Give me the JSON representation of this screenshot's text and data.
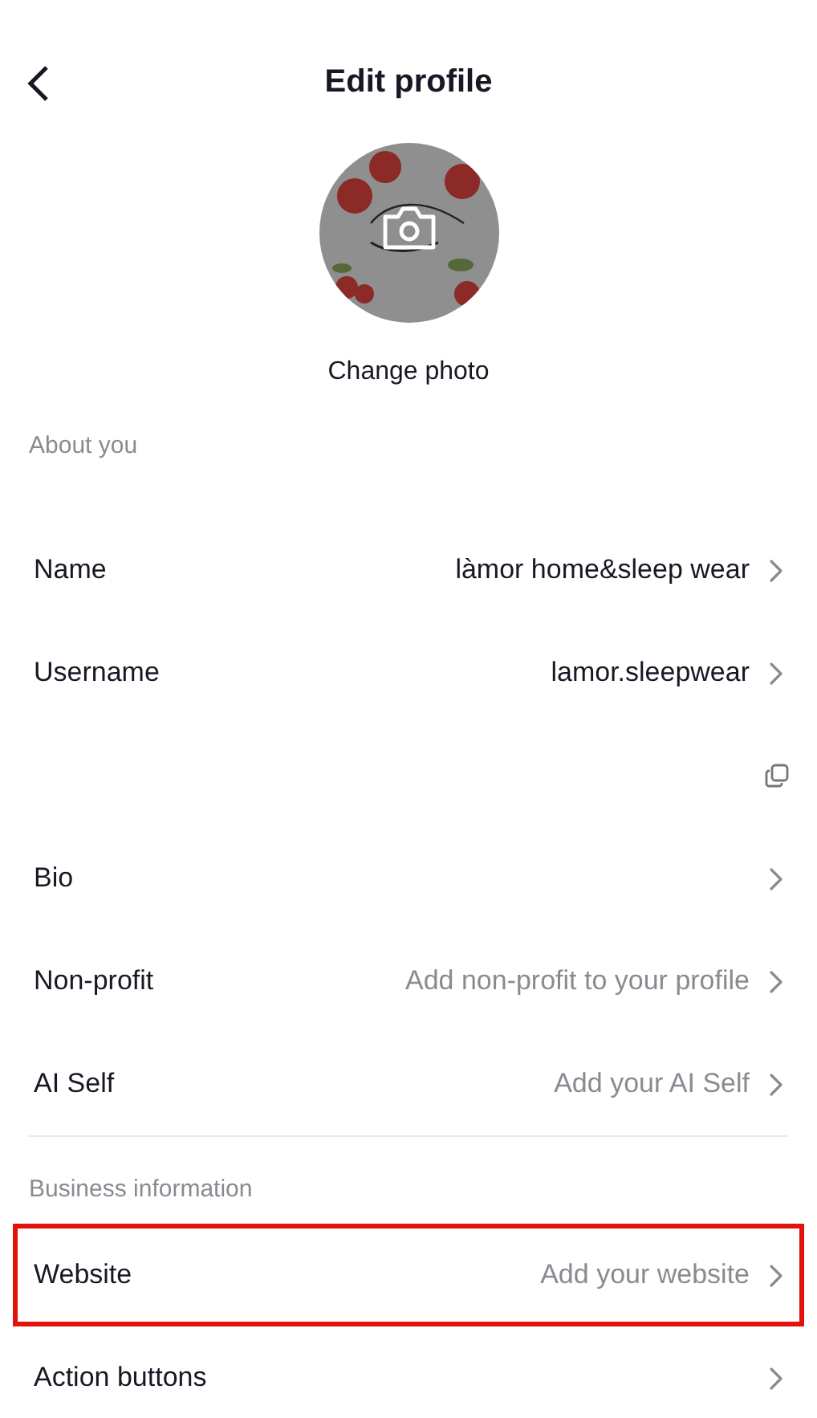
{
  "header": {
    "title": "Edit profile"
  },
  "photo": {
    "label": "Change photo"
  },
  "sections": [
    {
      "title": "About you",
      "rows": [
        {
          "kind": "link",
          "label": "Name",
          "value": "làmor home&sleep wear",
          "muted": false,
          "highlighted": false
        },
        {
          "kind": "link",
          "label": "Username",
          "value": "lamor.sleepwear",
          "muted": false,
          "highlighted": false
        },
        {
          "kind": "copy",
          "highlighted": false
        },
        {
          "kind": "link",
          "label": "Bio",
          "highlighted": false
        },
        {
          "kind": "link",
          "label": "Non-profit",
          "value": "Add non-profit to your profile",
          "muted": true,
          "highlighted": false
        },
        {
          "kind": "link",
          "label": "AI Self",
          "value": "Add your AI Self",
          "muted": true,
          "highlighted": false
        }
      ]
    },
    {
      "title": "Business information",
      "rows": [
        {
          "kind": "link",
          "label": "Website",
          "value": "Add your website",
          "muted": true,
          "highlighted": true
        },
        {
          "kind": "link",
          "label": "Action buttons",
          "highlighted": false
        }
      ]
    }
  ]
}
